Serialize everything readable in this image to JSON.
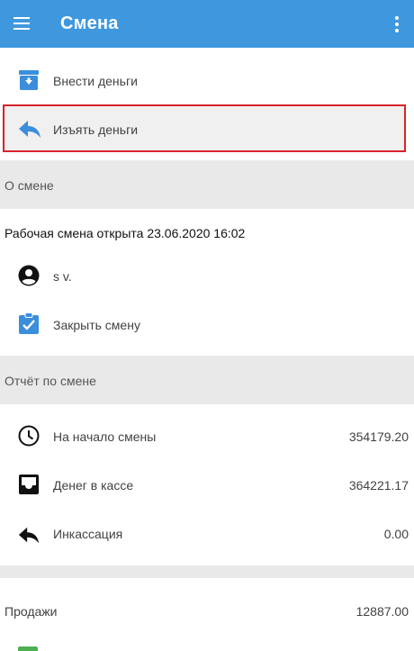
{
  "appbar": {
    "title": "Смена",
    "menu_icon": "hamburger-menu-icon",
    "more_icon": "more-vert-icon"
  },
  "actions": {
    "deposit_label": "Внести деньги",
    "withdraw_label": "Изъять деньги"
  },
  "about_section": {
    "title": "О смене"
  },
  "shift": {
    "status": "Рабочая смена открыта 23.06.2020 16:02",
    "user": "s v.",
    "close_label": "Закрыть смену"
  },
  "report_section": {
    "title": "Отчёт по смене"
  },
  "report": {
    "start_label": "На начало смены",
    "start_value": "354179.20",
    "cash_label": "Денег в кассе",
    "cash_value": "364221.17",
    "collection_label": "Инкассация",
    "collection_value": "0.00",
    "sales_label": "Продажи",
    "sales_value": "12887.00"
  },
  "colors": {
    "appbar": "#3f98de",
    "accent": "#3b8edb",
    "highlight_border": "#d9222a",
    "section_bg": "#e9e9e9"
  }
}
